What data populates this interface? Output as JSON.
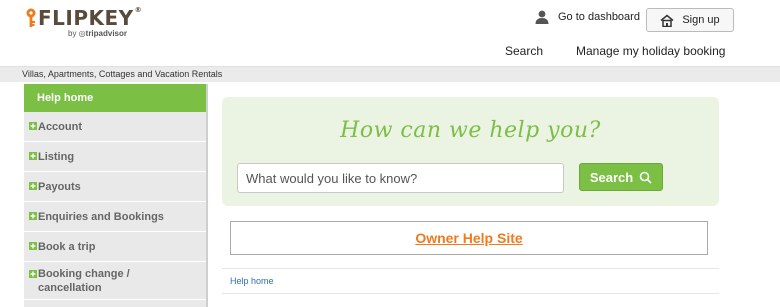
{
  "header": {
    "logo_text": "FLIPKEY",
    "logo_mark": "®",
    "logo_sub_by": "by",
    "logo_sub_brand": "tripadvisor",
    "dashboard_label": "Go to dashboard",
    "signup_label": "Sign up",
    "nav_search": "Search",
    "nav_manage": "Manage my holiday booking",
    "tagline": "Villas, Apartments, Cottages and Vacation Rentals"
  },
  "sidebar": {
    "active": "Help home",
    "items": [
      {
        "label": "Account"
      },
      {
        "label": "Listing"
      },
      {
        "label": "Payouts"
      },
      {
        "label": "Enquiries and Bookings"
      },
      {
        "label": "Book a trip"
      },
      {
        "label": "Booking change / cancellation"
      }
    ]
  },
  "main": {
    "heading": "How can we help you?",
    "search_placeholder": "What would you like to know?",
    "search_button": "Search",
    "owner_link": "Owner Help Site",
    "breadcrumb": "Help home"
  },
  "colors": {
    "accent_green": "#7bbf44",
    "owner_orange": "#f07a1c",
    "link_blue": "#2e6fb5"
  },
  "icons": [
    "key-icon",
    "user-icon",
    "home-icon",
    "plus-icon",
    "search-icon"
  ]
}
